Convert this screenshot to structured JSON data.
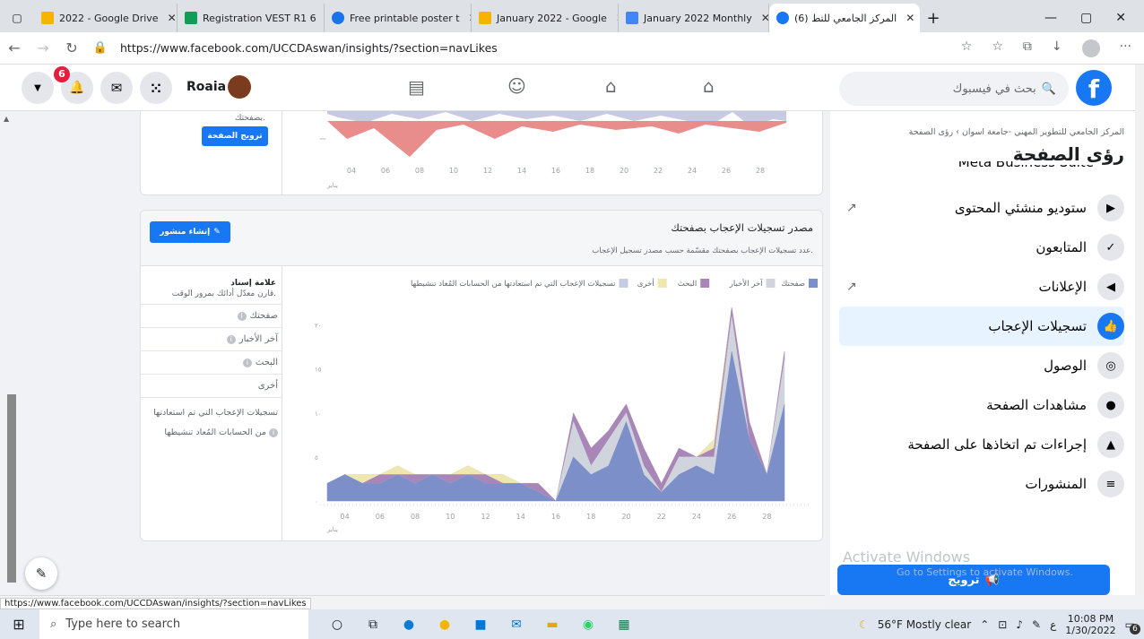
{
  "browser": {
    "tabs": [
      {
        "title": "2022 - Google Drive",
        "color": "#f4b400"
      },
      {
        "title": "Registration VEST R1 6",
        "color": "#0f9d58"
      },
      {
        "title": "Free printable poster t",
        "color": "#1a73e8"
      },
      {
        "title": "January 2022 - Google",
        "color": "#f4b400"
      },
      {
        "title": "January 2022 Monthly",
        "color": "#4285f4"
      },
      {
        "title": "(6) المركز الجامعي للتط",
        "color": "#1877f2"
      }
    ],
    "url": "https://www.facebook.com/UCCDAswan/insights/?section=navLikes",
    "status_url": "https://www.facebook.com/UCCDAswan/insights/?section=navLikes"
  },
  "header": {
    "notif_count": "6",
    "user_name": "Roaia",
    "search_placeholder": "بحث في فيسبوك"
  },
  "top_card": {
    "promote_label": "ترويج الصفحة",
    "sidebar_text": "بصفحتك.",
    "x_ticks": [
      "04",
      "06",
      "08",
      "10",
      "12",
      "14",
      "16",
      "18",
      "20",
      "22",
      "24",
      "26",
      "28"
    ],
    "month": "يناير"
  },
  "likes_card": {
    "title": "مصدر تسجيلات الإعجاب بصفحتك",
    "subtitle": "عدد تسجيلات الإعجاب بصفحتك مقسّمة حسب مصدر تسجيل الإعجاب.",
    "create_post": "إنشاء منشور",
    "benchmark_title": "علامة إسناد",
    "benchmark_sub": "قارن معدّل أدائك بمرور الوقت.",
    "benchmark_rows": [
      "صفحتك",
      "آخر الأخبار",
      "البحث",
      "أخرى",
      "تسجيلات الإعجاب التي تم استعادتها من الحسابات المُعاد تنشيطها"
    ]
  },
  "chart_data": {
    "type": "area",
    "x": [
      "03",
      "04",
      "05",
      "06",
      "07",
      "08",
      "09",
      "10",
      "11",
      "12",
      "13",
      "14",
      "15",
      "16",
      "17",
      "18",
      "19",
      "20",
      "21",
      "22",
      "23",
      "24",
      "25",
      "26",
      "27",
      "28",
      "29"
    ],
    "x_ticks": [
      "04",
      "06",
      "08",
      "10",
      "12",
      "14",
      "16",
      "18",
      "20",
      "22",
      "24",
      "26",
      "28"
    ],
    "x_month_label": "يناير",
    "y_ticks": [
      "٠",
      "٥",
      "١٠",
      "١٥",
      "٢٠"
    ],
    "ylim": [
      0,
      22
    ],
    "legend_position": "top",
    "series": [
      {
        "name": "صفحتك",
        "color": "#7d8fc9",
        "values": [
          2,
          3,
          2,
          2,
          3,
          2,
          3,
          2,
          3,
          2,
          2,
          2,
          1,
          0,
          5,
          3,
          4,
          9,
          3,
          1,
          3,
          4,
          3,
          17,
          7,
          3,
          11
        ]
      },
      {
        "name": "آخر الأخبار",
        "color": "#d0d4dc",
        "values": [
          0,
          0,
          0,
          0,
          0,
          0,
          0,
          0,
          0,
          0,
          0,
          0,
          0,
          0,
          4,
          1,
          3,
          1,
          1,
          0,
          2,
          1,
          2,
          4,
          0,
          0,
          5
        ]
      },
      {
        "name": "البحث",
        "color": "#a986b8",
        "values": [
          0,
          0,
          0,
          1,
          0,
          1,
          0,
          1,
          0,
          1,
          0,
          0,
          1,
          0,
          1,
          2,
          1,
          1,
          2,
          1,
          1,
          0,
          1,
          1,
          2,
          0,
          1
        ]
      },
      {
        "name": "أخرى",
        "color": "#efe6b0",
        "values": [
          0,
          0,
          1,
          0,
          1,
          0,
          0,
          0,
          1,
          0,
          1,
          0,
          0,
          0,
          0,
          0,
          0,
          0,
          0,
          0,
          0,
          0,
          1,
          0,
          0,
          0,
          0
        ]
      },
      {
        "name": "تسجيلات الإعجاب التي تم استعادتها من الحسابات المُعاد تنشيطها",
        "color": "#c5cbe0",
        "values": [
          0,
          0,
          0,
          0,
          0,
          0,
          0,
          0,
          0,
          0,
          0,
          0,
          0,
          0,
          0,
          0,
          0,
          0,
          0,
          0,
          0,
          0,
          0,
          0,
          0,
          0,
          0
        ]
      }
    ]
  },
  "sidebar": {
    "breadcrumb": "المركز الجامعي للتطوير المهني -جامعة اسوان › رؤى الصفحة",
    "page_title": "رؤى الصفحة",
    "cut_item": "Meta Business Suite",
    "items": [
      {
        "label": "ستوديو منشئي المحتوى",
        "icon": "▶",
        "ext": true
      },
      {
        "label": "المتابعون",
        "icon": "✓",
        "ext": false
      },
      {
        "label": "الإعلانات",
        "icon": "◀",
        "ext": true
      },
      {
        "label": "تسجيلات الإعجاب",
        "icon": "👍",
        "ext": false,
        "selected": true
      },
      {
        "label": "الوصول",
        "icon": "◎",
        "ext": false
      },
      {
        "label": "مشاهدات الصفحة",
        "icon": "●",
        "ext": false
      },
      {
        "label": "إجراءات تم اتخاذها على الصفحة",
        "icon": "▲",
        "ext": false
      },
      {
        "label": "المنشورات",
        "icon": "≡",
        "ext": false
      }
    ],
    "promote_button": "ترويج",
    "watermark1": "Activate Windows",
    "watermark2": "Go to Settings to activate Windows."
  },
  "taskbar": {
    "search": "Type here to search",
    "weather": "56°F  Mostly clear",
    "time": "10:08 PM",
    "date": "1/30/2022",
    "notif": "6",
    "lang": "ع"
  }
}
